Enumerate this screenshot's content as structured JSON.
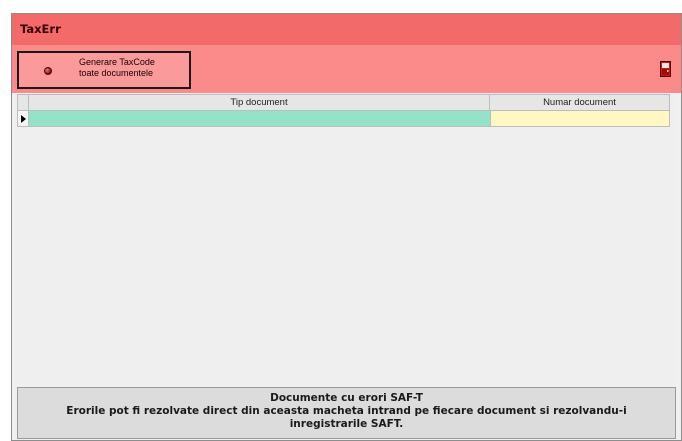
{
  "window": {
    "title": "TaxErr"
  },
  "toolbar": {
    "generate_button": {
      "line1": "Generare TaxCode",
      "line2": "toate documentele"
    },
    "exit_icon": "exit-door-icon"
  },
  "grid": {
    "columns": [
      "Tip document",
      "Numar document"
    ],
    "rows": [
      {
        "tip_document": "",
        "numar_document": ""
      }
    ]
  },
  "footer": {
    "title": "Documente cu erori SAF-T",
    "description": "Erorile pot fi rezolvate direct din aceasta macheta intrand pe fiecare document si rezolvandu-i inregistrarile SAFT."
  },
  "colors": {
    "title_bar": "#f36a6a",
    "toolbar": "#fb8a8a",
    "tip_cell": "#94e3c8",
    "numar_cell": "#fff8c4"
  }
}
